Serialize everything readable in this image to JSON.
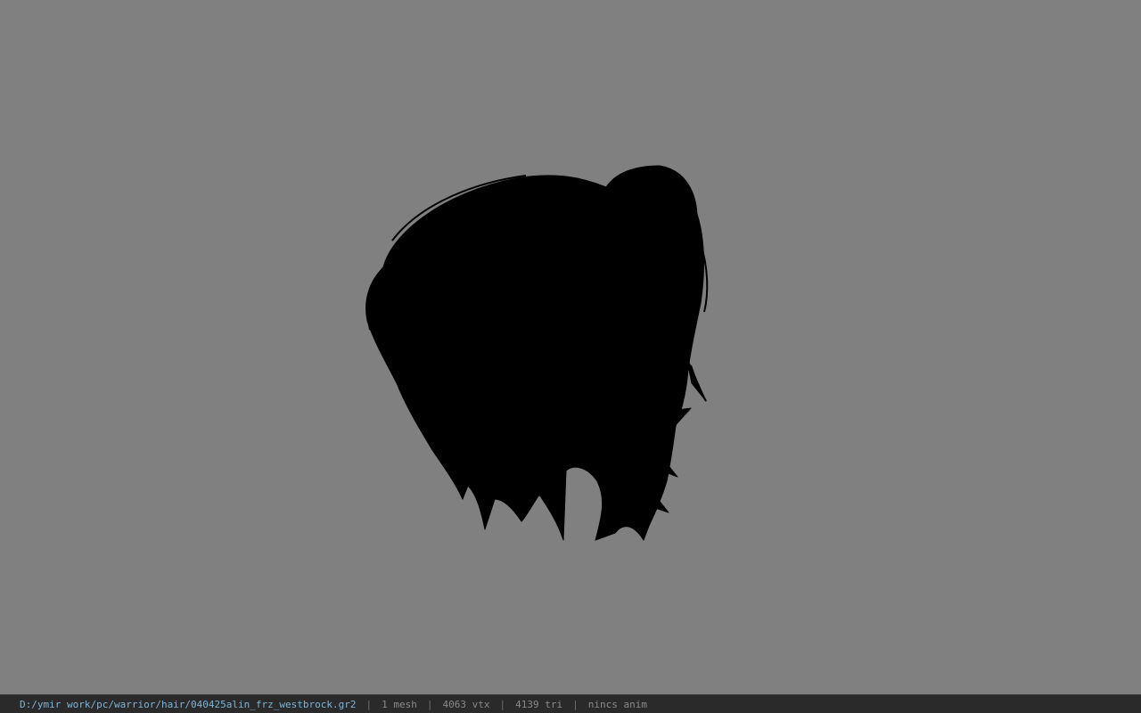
{
  "viewport": {
    "background_color": "#808080",
    "model_color": "#000000"
  },
  "status": {
    "path": "D:/ymir work/pc/warrior/hair/040425alin_frz_westbrock.gr2",
    "separator": "|",
    "mesh_count": "1 mesh",
    "vertex_count": "4063 vtx",
    "triangle_count": "4139 tri",
    "anim_status": "nincs anim",
    "path_color": "#7fb3d5",
    "text_color": "#8a8a8a"
  }
}
